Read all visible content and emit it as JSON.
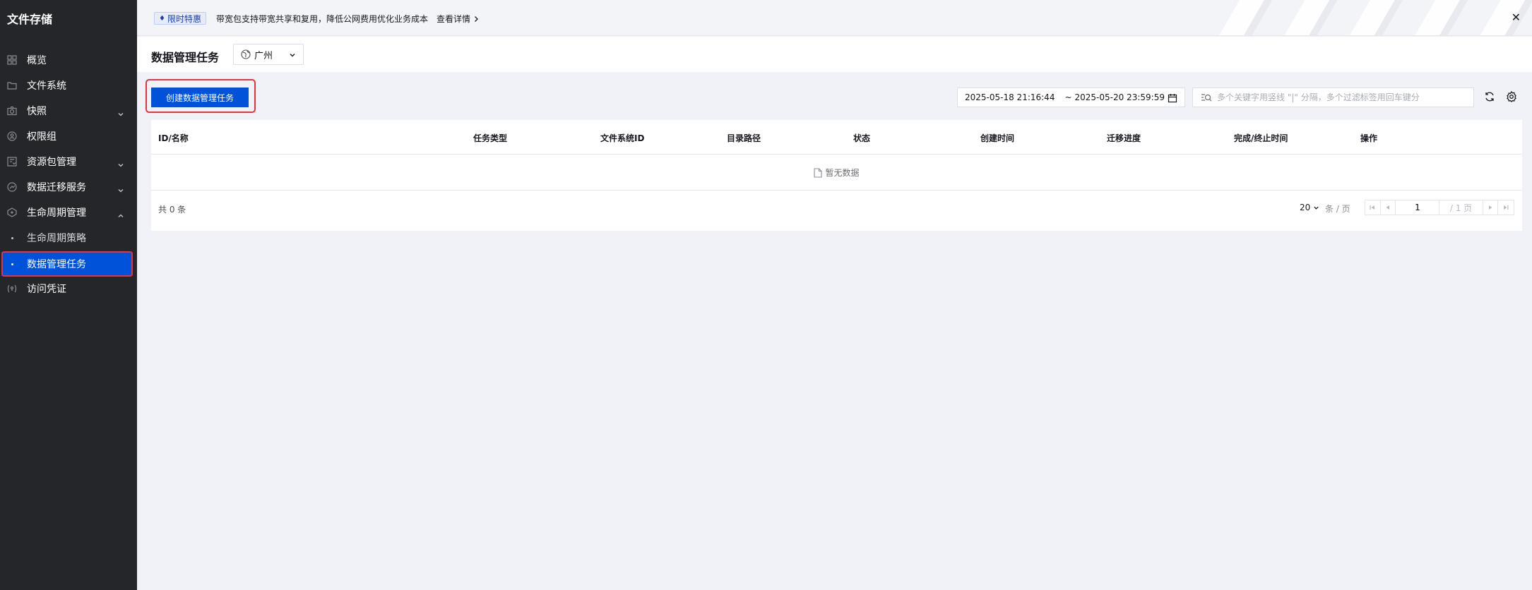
{
  "sidebar": {
    "title": "文件存储",
    "items": [
      {
        "label": "概览",
        "icon": "grid-icon"
      },
      {
        "label": "文件系统",
        "icon": "folder-icon"
      },
      {
        "label": "快照",
        "icon": "camera-icon",
        "expandable": true
      },
      {
        "label": "权限组",
        "icon": "permission-icon"
      },
      {
        "label": "资源包管理",
        "icon": "package-icon",
        "expandable": true
      },
      {
        "label": "数据迁移服务",
        "icon": "migration-icon",
        "expandable": true
      },
      {
        "label": "生命周期管理",
        "icon": "lifecycle-icon",
        "expandable": true,
        "expanded": true
      },
      {
        "label": "生命周期策略",
        "sub": true
      },
      {
        "label": "数据管理任务",
        "sub": true,
        "active": true
      },
      {
        "label": "访问凭证",
        "icon": "credential-icon"
      }
    ]
  },
  "banner": {
    "badge": "限时特惠",
    "text": "带宽包支持带宽共享和复用，降低公网费用优化业务成本",
    "link": "查看详情"
  },
  "header": {
    "title": "数据管理任务",
    "region": "广州"
  },
  "toolbar": {
    "create_label": "创建数据管理任务",
    "date_start": "2025-05-18 21:16:44",
    "date_sep": "~",
    "date_end": "2025-05-20 23:59:59",
    "search_placeholder": "多个关键字用竖线 \"|\" 分隔，多个过滤标签用回车键分"
  },
  "table": {
    "columns": [
      "ID/名称",
      "任务类型",
      "文件系统ID",
      "目录路径",
      "状态",
      "创建时间",
      "迁移进度",
      "完成/终止时间",
      "操作"
    ],
    "empty_text": "暂无数据",
    "total": "共 0 条",
    "page_size": "20",
    "per_page": "条 / 页",
    "current_page": "1",
    "total_pages": "/ 1 页"
  },
  "colors": {
    "primary": "#0052d9",
    "sidebar_bg": "#242629",
    "highlight": "#e5343c"
  }
}
